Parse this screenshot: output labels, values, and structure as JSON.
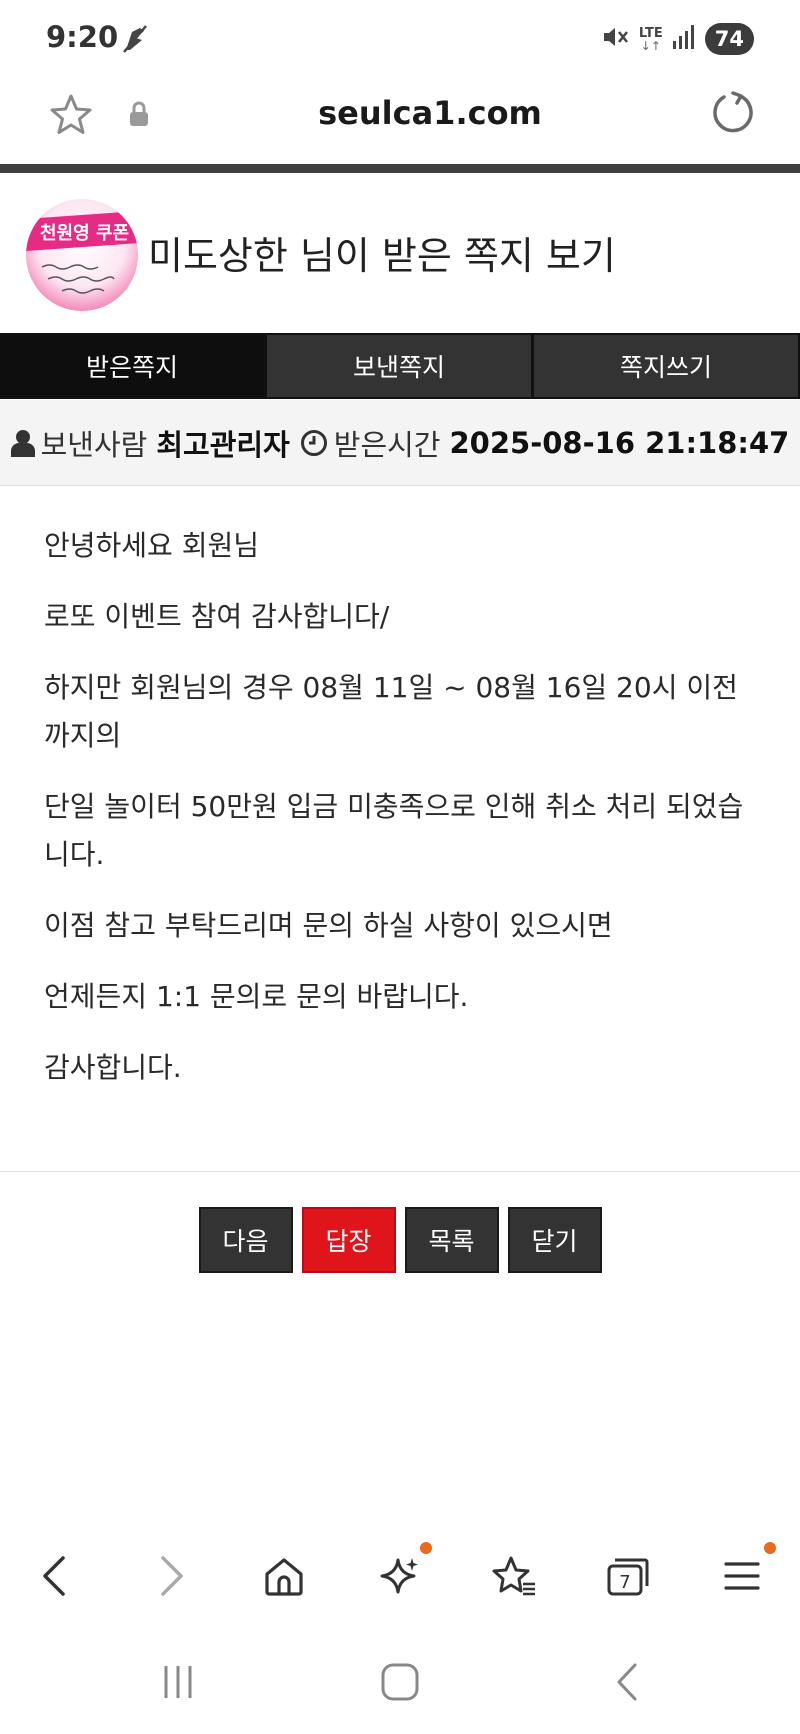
{
  "status_bar": {
    "time": "9:20",
    "network": "LTE",
    "battery": "74"
  },
  "browser": {
    "url": "seulca1.com"
  },
  "header": {
    "avatar_text": "천원영 쿠폰",
    "title": "미도상한 님이 받은 쪽지 보기"
  },
  "tabs": [
    {
      "label": "받은쪽지",
      "active": true
    },
    {
      "label": "보낸쪽지",
      "active": false
    },
    {
      "label": "쪽지쓰기",
      "active": false
    }
  ],
  "meta": {
    "sender_label": "보낸사람",
    "sender_name": "최고관리자",
    "received_label": "받은시간",
    "received_time": "2025-08-16 21:18:47"
  },
  "message": {
    "paragraphs": [
      "안녕하세요 회원님",
      "로또 이벤트 참여 감사합니다/",
      "하지만 회원님의 경우 08월 11일 ~ 08월 16일 20시 이전까지의",
      "단일 놀이터 50만원 입금 미충족으로 인해 취소 처리 되었습니다.",
      "이점 참고 부탁드리며 문의 하실 사항이 있으시면",
      "언제든지 1:1 문의로 문의 바랍니다.",
      "감사합니다."
    ]
  },
  "actions": {
    "next": "다음",
    "reply": "답장",
    "list": "목록",
    "close": "닫기"
  },
  "bottom_nav": {
    "tabs_count": "7",
    "icons": [
      "back-icon",
      "forward-icon",
      "home-icon",
      "sparkle-icon",
      "bookmarks-icon",
      "tabs-icon",
      "menu-icon"
    ]
  },
  "colors": {
    "reply_button": "#e0151c",
    "dark_button": "#333333",
    "notification_dot": "#ea6a1e"
  }
}
